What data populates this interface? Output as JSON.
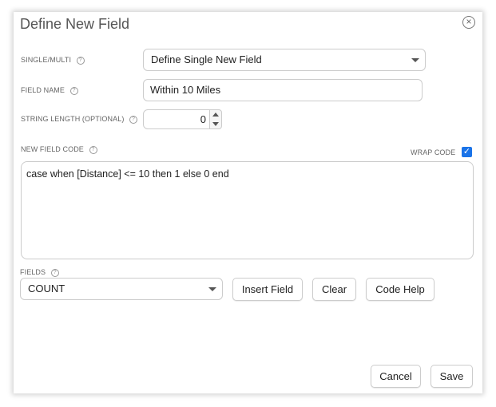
{
  "dialog": {
    "title": "Define New Field",
    "close_icon": "close-circle-icon"
  },
  "single_multi": {
    "label": "SINGLE/MULTI",
    "value": "Define Single New Field"
  },
  "field_name": {
    "label": "FIELD NAME",
    "value": "Within 10 Miles"
  },
  "string_length": {
    "label": "STRING LENGTH (OPTIONAL)",
    "value": "0"
  },
  "new_field_code": {
    "label": "NEW FIELD CODE",
    "wrap_label": "WRAP CODE",
    "wrap_checked": true,
    "code": "case when [Distance] <= 10 then 1 else 0 end"
  },
  "fields": {
    "label": "FIELDS",
    "value": "COUNT",
    "insert_label": "Insert Field",
    "clear_label": "Clear",
    "help_label": "Code Help"
  },
  "footer": {
    "cancel_label": "Cancel",
    "save_label": "Save"
  },
  "help_glyph": "?",
  "accent_color": "#1a73e8"
}
